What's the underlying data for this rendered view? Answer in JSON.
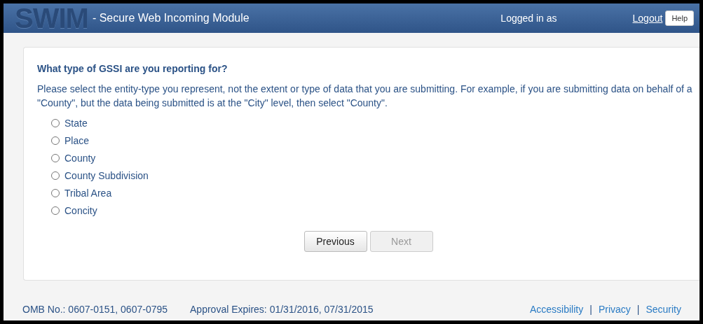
{
  "header": {
    "logo": "SWIM",
    "title": "- Secure Web Incoming Module",
    "logged_in": "Logged in as",
    "logout": "Logout",
    "help": "Help"
  },
  "question": {
    "title": "What type of GSSI are you reporting for?",
    "description": "Please select the entity-type you represent, not the extent or type of data that you are submitting. For example, if you are submitting data on behalf of a \"County\", but the data being submitted is at the \"City\" level, then select \"County\".",
    "options": [
      {
        "label": "State",
        "selected": false
      },
      {
        "label": "Place",
        "selected": false
      },
      {
        "label": "County",
        "selected": false
      },
      {
        "label": "County Subdivision",
        "selected": false
      },
      {
        "label": "Tribal Area",
        "selected": false
      },
      {
        "label": "Concity",
        "selected": false
      }
    ]
  },
  "buttons": [
    {
      "label": "Previous",
      "disabled": false
    },
    {
      "label": "Next",
      "disabled": true
    }
  ],
  "footer": {
    "omb": "OMB No.: 0607-0151, 0607-0795",
    "approval": "Approval Expires: 01/31/2016, 07/31/2015",
    "links": [
      "Accessibility",
      "Privacy",
      "Security"
    ],
    "separators": [
      "|",
      "|"
    ]
  }
}
